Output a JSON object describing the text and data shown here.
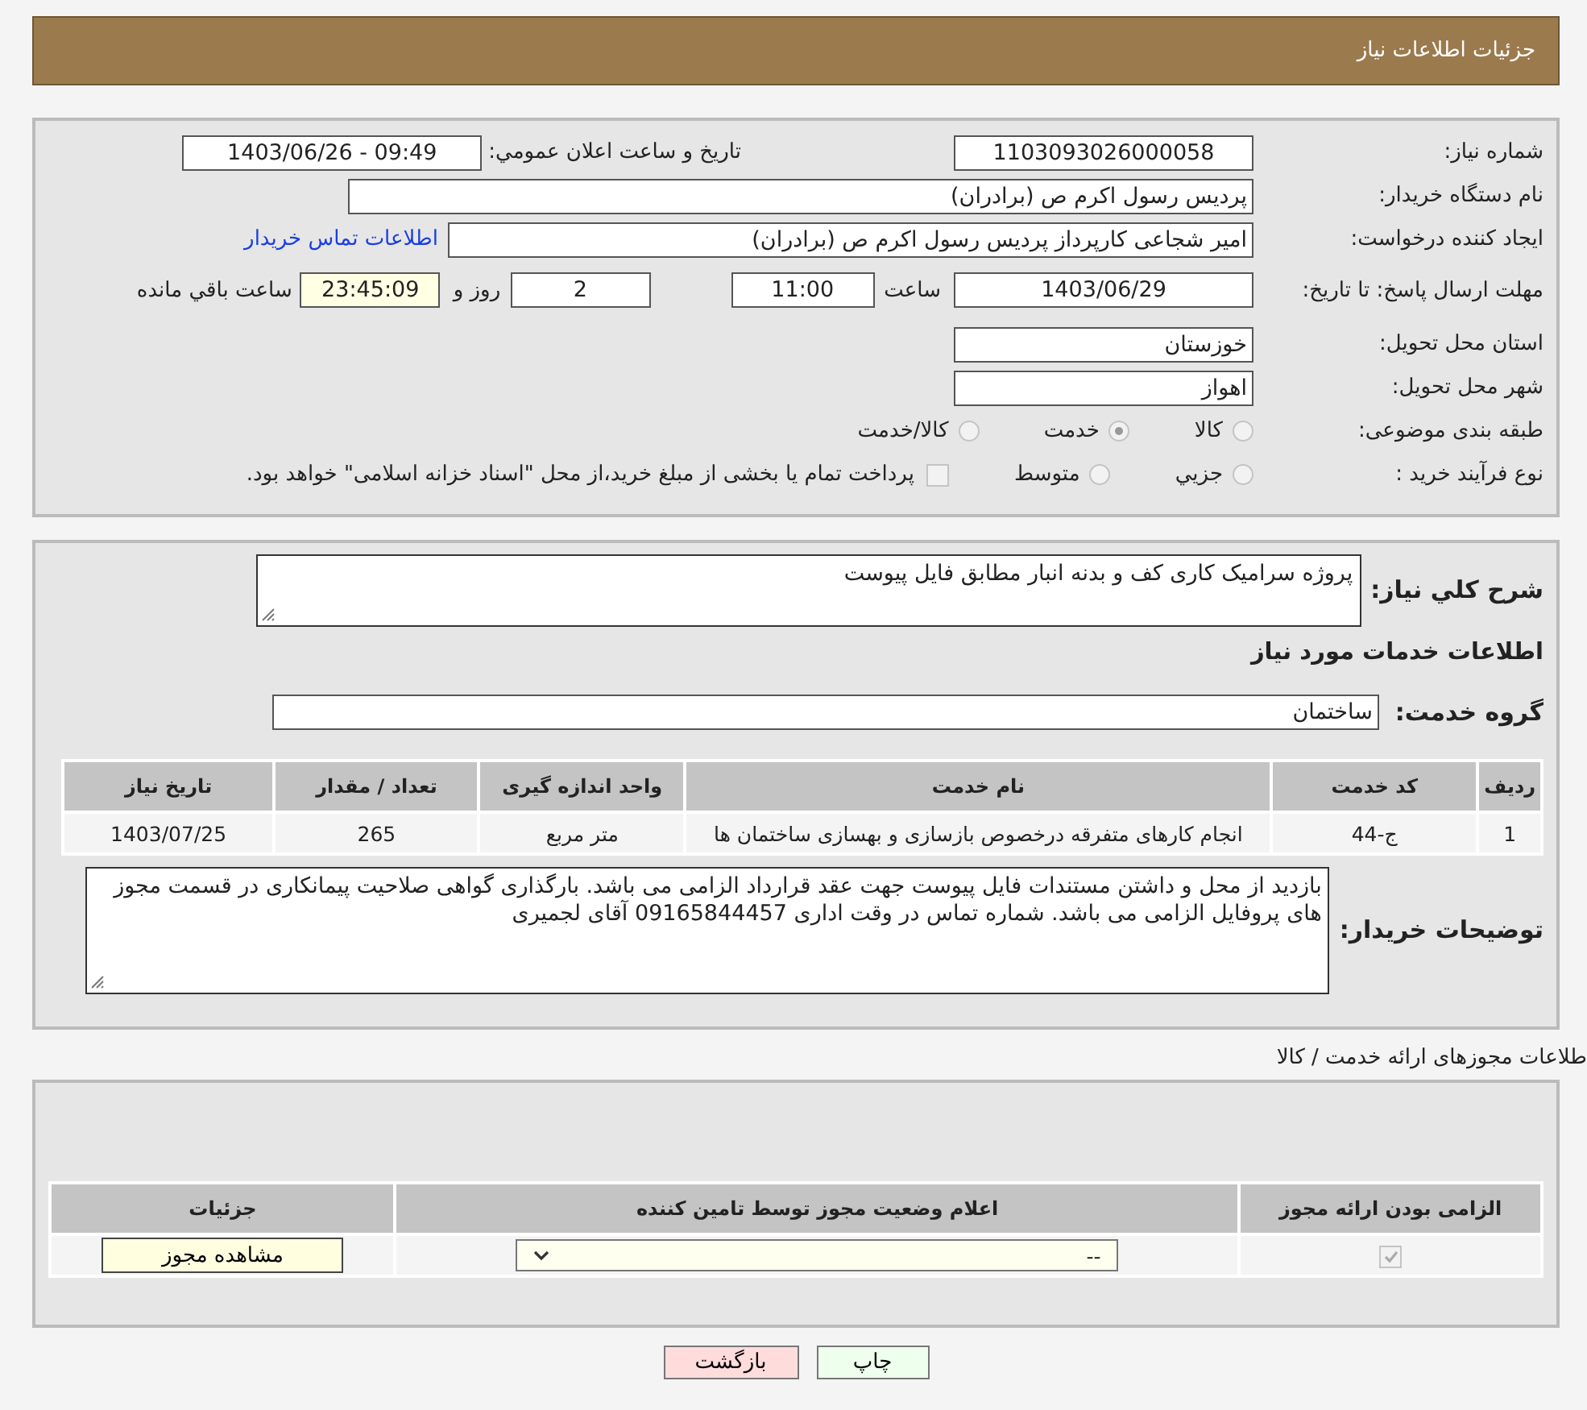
{
  "header": {
    "title": "جزئیات اطلاعات نیاز"
  },
  "details": {
    "need_number": {
      "label": "شماره نیاز:",
      "value": "1103093026000058"
    },
    "announce": {
      "label": "تاریخ و ساعت اعلان عمومي:",
      "value": "1403/06/26 - 09:49"
    },
    "buyer_org": {
      "label": "نام دستگاه خریدار:",
      "value": "پردیس رسول اکرم ص (برادران)"
    },
    "requester": {
      "label": "ایجاد کننده درخواست:",
      "value": "امیر  شجاعی کارپرداز پردیس رسول اکرم ص (برادران)",
      "link": "اطلاعات تماس خریدار"
    },
    "deadline": {
      "label": "مهلت ارسال پاسخ: تا تاریخ:",
      "date": "1403/06/29",
      "time_label": "ساعت",
      "time": "11:00",
      "days": "2",
      "days_label": "روز و",
      "remaining": "23:45:09",
      "remaining_label": "ساعت باقي مانده"
    },
    "province": {
      "label": "استان محل تحویل:",
      "value": "خوزستان"
    },
    "city": {
      "label": "شهر محل تحویل:",
      "value": "اهواز"
    },
    "category": {
      "label": "طبقه بندی موضوعی:",
      "options": [
        {
          "label": "کالا",
          "selected": false
        },
        {
          "label": "خدمت",
          "selected": true
        },
        {
          "label": "کالا/خدمت",
          "selected": false
        }
      ]
    },
    "process": {
      "label": "نوع فرآیند خرید :",
      "options": [
        {
          "label": "جزیي",
          "selected": false
        },
        {
          "label": "متوسط",
          "selected": false
        }
      ],
      "payment_checked": false,
      "note": "پرداخت تمام یا بخشی از مبلغ خرید،از محل \"اسناد خزانه اسلامی\" خواهد بود."
    }
  },
  "summary": {
    "label": "شرح کلي نیاز:",
    "value": "پروژه سرامیک کاری کف و بدنه انبار مطابق فایل پیوست"
  },
  "services_title": "اطلاعات خدمات مورد نیاز",
  "service_group": {
    "label": "گروه خدمت:",
    "value": "ساختمان"
  },
  "services_table": {
    "columns": [
      "ردیف",
      "کد خدمت",
      "نام خدمت",
      "واحد اندازه گیری",
      "تعداد / مقدار",
      "تاریخ نیاز"
    ],
    "rows": [
      [
        "1",
        "ج-44",
        "انجام کارهای متفرقه درخصوص بازسازی و بهسازی ساختمان ها",
        "متر مربع",
        "265",
        "1403/07/25"
      ]
    ]
  },
  "buyer_notes": {
    "label": "توضیحات خریدار:",
    "value": "بازدید از محل و داشتن مستندات فایل پیوست جهت عقد قرارداد الزامی می باشد. بارگذاری گواهی صلاحیت پیمانکاری در قسمت مجوز های پروفایل الزامی می باشد. شماره تماس در وقت اداری 09165844457 آقای لجمیری"
  },
  "permits": {
    "title": "طلاعات مجوزهای ارائه خدمت / کالا",
    "columns": [
      "الزامی بودن ارائه مجوز",
      "اعلام وضعیت مجوز توسط تامین کننده",
      "جزئیات"
    ],
    "rows": [
      {
        "required": true,
        "status": "--",
        "action": "مشاهده مجوز"
      }
    ]
  },
  "buttons": [
    {
      "label": "چاپ",
      "kind": "print"
    },
    {
      "label": "بازگشت",
      "kind": "back"
    }
  ]
}
